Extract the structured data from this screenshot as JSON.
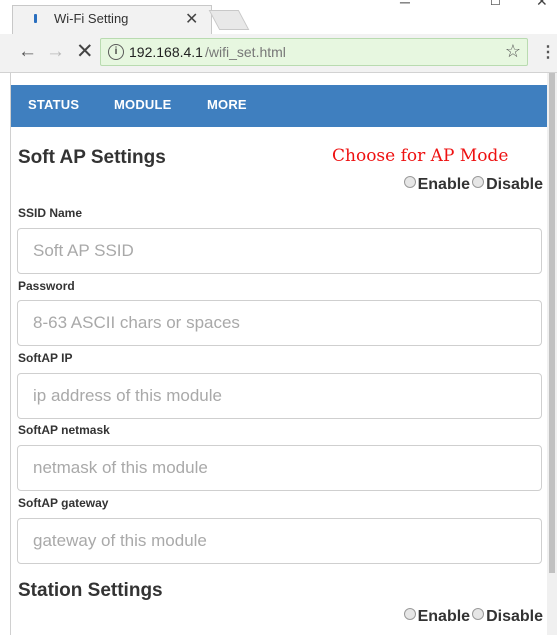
{
  "browser": {
    "tab_title": "Wi-Fi Setting",
    "url_host": "192.168.4.1",
    "url_path": "/wifi_set.html"
  },
  "nav": {
    "items": [
      "STATUS",
      "MODULE",
      "MORE"
    ]
  },
  "softap": {
    "heading": "Soft AP Settings",
    "annotation": "Choose for AP Mode",
    "enable_label": "Enable",
    "disable_label": "Disable",
    "fields": [
      {
        "label": "SSID Name",
        "placeholder": "Soft AP SSID",
        "value": ""
      },
      {
        "label": "Password",
        "placeholder": "8-63 ASCII chars or spaces",
        "value": ""
      },
      {
        "label": "SoftAP IP",
        "placeholder": "ip address of this module",
        "value": ""
      },
      {
        "label": "SoftAP netmask",
        "placeholder": "netmask of this module",
        "value": ""
      },
      {
        "label": "SoftAP gateway",
        "placeholder": "gateway of this module",
        "value": ""
      }
    ]
  },
  "station": {
    "heading": "Station Settings",
    "enable_label": "Enable",
    "disable_label": "Disable"
  },
  "colors": {
    "navbar": "#3f7fbf",
    "annotation": "#ee1111",
    "omnibox_secure": "#e7f7e0"
  }
}
